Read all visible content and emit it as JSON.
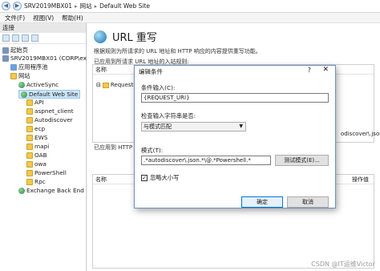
{
  "address": {
    "crumbs": [
      "SRV2019MBX01",
      "网站",
      "Default Web Site"
    ]
  },
  "menu": {
    "items": [
      "文件(F)",
      "视图(V)",
      "帮助(H)"
    ]
  },
  "connections": {
    "header": "连接",
    "tree": [
      {
        "label": "起始页",
        "icon": "home-icon",
        "depth": 1
      },
      {
        "label": "SRV2019MBX01 (CORP\\ex",
        "icon": "server-icon",
        "depth": 1
      },
      {
        "label": "应用程序池",
        "icon": "app-pool-icon",
        "depth": 2
      },
      {
        "label": "网站",
        "icon": "folder-icon",
        "depth": 2
      },
      {
        "label": "ActiveSync",
        "icon": "globe-icon",
        "depth": 3
      },
      {
        "label": "Default Web Site",
        "icon": "globe-icon",
        "depth": 3,
        "selected": true
      },
      {
        "label": "API",
        "icon": "folder-icon",
        "depth": 4
      },
      {
        "label": "aspnet_client",
        "icon": "folder-icon",
        "depth": 4
      },
      {
        "label": "Autodiscover",
        "icon": "folder-icon",
        "depth": 4
      },
      {
        "label": "ecp",
        "icon": "folder-icon",
        "depth": 4
      },
      {
        "label": "EWS",
        "icon": "folder-icon",
        "depth": 4
      },
      {
        "label": "mapi",
        "icon": "folder-icon",
        "depth": 4
      },
      {
        "label": "OAB",
        "icon": "folder-icon",
        "depth": 4
      },
      {
        "label": "owa",
        "icon": "folder-icon",
        "depth": 4
      },
      {
        "label": "PowerShell",
        "icon": "folder-icon",
        "depth": 4
      },
      {
        "label": "Rpc",
        "icon": "folder-icon",
        "depth": 4
      },
      {
        "label": "Exchange Back End",
        "icon": "globe-icon",
        "depth": 3
      }
    ]
  },
  "main": {
    "title": "URL 重写",
    "description": "根据规则为所请求的 URL 地址和 HTTP 响应的内容提供重写功能。",
    "rules_caption": "已应用到所请求 URL 地址的入站规则:",
    "col_name": "名称",
    "rule_name": "RequestB",
    "rule_value_right": "odiscover\\.json.*",
    "vars_caption": "已应用到 HTTP 响",
    "vars_col_name": "名称",
    "vars_col_action": "操作值"
  },
  "dialog": {
    "title": "编辑条件",
    "help": "?",
    "close": "✕",
    "condition_input_label": "条件输入(C):",
    "condition_input_value": "{REQUEST_URI}",
    "check_label": "检查输入字符串是否:",
    "check_value": "与模式匹配",
    "pattern_label": "模式(T):",
    "pattern_value": ".*autodiscover\\.json.*\\@.*Powershell.*",
    "test_button": "测试模式(E)...",
    "ignore_case_label": "忽略大小写",
    "ignore_case_checked": true,
    "ok_button": "确定",
    "cancel_button": "取消"
  },
  "watermark": "CSDN @IT运维Victor"
}
